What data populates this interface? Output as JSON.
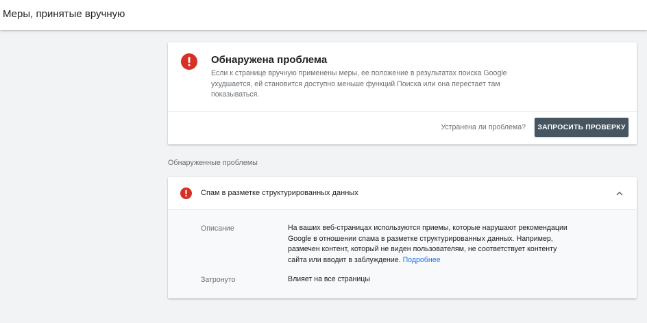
{
  "header": {
    "title": "Меры, принятые вручную"
  },
  "issue_card": {
    "heading": "Обнаружена проблема",
    "description": "Если к странице вручную применены меры, ее положение в результатах поиска Google ухудшается, ей становится доступно меньше функций Поиска или она перестает там показываться.",
    "question": "Устранена ли проблема?",
    "validate_button_label": "ЗАПРОСИТЬ ПРОВЕРКУ",
    "icon": "error-icon",
    "icon_color": "#d93025"
  },
  "section": {
    "label": "Обнаруженные проблемы"
  },
  "detected_issue": {
    "title": "Спам в разметке структурированных данных",
    "icon": "error-icon",
    "expanded": true,
    "description_label": "Описание",
    "description_text": "На ваших веб-страницах используются приемы, которые нарушают рекомендации Google в отношении спама в разметке структурированных данных. Например, размечен контент, который не виден пользователям, не соответствует контенту сайта или вводит в заблуждение.",
    "learn_more_label": "Подробнее",
    "affected_label": "Затронуто",
    "affected_value": "Влияет на все страницы"
  },
  "colors": {
    "accent_button": "#46555f",
    "link": "#1a73e8",
    "error": "#d93025",
    "background": "#f1f3f4"
  }
}
